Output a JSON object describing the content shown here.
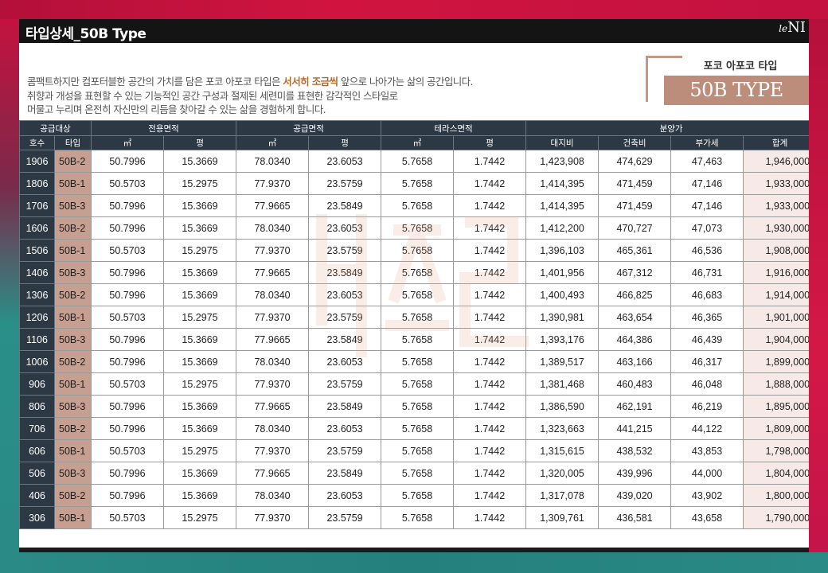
{
  "header": {
    "title": "타입상세_50B Type",
    "logo_main": "NI",
    "logo_prefix": "le"
  },
  "intro": {
    "line1_before": "콤팩트하지만 컴포터블한 공간의 가치를 담은 포코 아포코 타입은 ",
    "line1_highlight": "서서히 조금씩",
    "line1_after": " 앞으로 나아가는 삶의 공간입니다.",
    "line2": "취향과 개성을 표현할 수 있는 기능적인 공간 구성과 절제된 세련미를 표현한 감각적인 스타일로",
    "line3": "머물고 누리며 온전히 자신만의 리듬을 찾아갈 수 있는 삶을 경험하게 합니다."
  },
  "type_badge": {
    "label": "포코 아포코 타입",
    "type": "50B TYPE"
  },
  "table": {
    "groups": [
      "공급대상",
      "전용면적",
      "공급면적",
      "테라스면적",
      "분양가"
    ],
    "columns": [
      "호수",
      "타입",
      "㎡",
      "평",
      "㎡",
      "평",
      "㎡",
      "평",
      "대지비",
      "건축비",
      "부가세",
      "합계"
    ],
    "rows": [
      [
        "1906",
        "50B-2",
        "50.7996",
        "15.3669",
        "78.0340",
        "23.6053",
        "5.7658",
        "1.7442",
        "1,423,908",
        "474,629",
        "47,463",
        "1,946,000"
      ],
      [
        "1806",
        "50B-1",
        "50.5703",
        "15.2975",
        "77.9370",
        "23.5759",
        "5.7658",
        "1.7442",
        "1,414,395",
        "471,459",
        "47,146",
        "1,933,000"
      ],
      [
        "1706",
        "50B-3",
        "50.7996",
        "15.3669",
        "77.9665",
        "23.5849",
        "5.7658",
        "1.7442",
        "1,414,395",
        "471,459",
        "47,146",
        "1,933,000"
      ],
      [
        "1606",
        "50B-2",
        "50.7996",
        "15.3669",
        "78.0340",
        "23.6053",
        "5.7658",
        "1.7442",
        "1,412,200",
        "470,727",
        "47,073",
        "1,930,000"
      ],
      [
        "1506",
        "50B-1",
        "50.5703",
        "15.2975",
        "77.9370",
        "23.5759",
        "5.7658",
        "1.7442",
        "1,396,103",
        "465,361",
        "46,536",
        "1,908,000"
      ],
      [
        "1406",
        "50B-3",
        "50.7996",
        "15.3669",
        "77.9665",
        "23.5849",
        "5.7658",
        "1.7442",
        "1,401,956",
        "467,312",
        "46,731",
        "1,916,000"
      ],
      [
        "1306",
        "50B-2",
        "50.7996",
        "15.3669",
        "78.0340",
        "23.6053",
        "5.7658",
        "1.7442",
        "1,400,493",
        "466,825",
        "46,683",
        "1,914,000"
      ],
      [
        "1206",
        "50B-1",
        "50.5703",
        "15.2975",
        "77.9370",
        "23.5759",
        "5.7658",
        "1.7442",
        "1,390,981",
        "463,654",
        "46,365",
        "1,901,000"
      ],
      [
        "1106",
        "50B-3",
        "50.7996",
        "15.3669",
        "77.9665",
        "23.5849",
        "5.7658",
        "1.7442",
        "1,393,176",
        "464,386",
        "46,439",
        "1,904,000"
      ],
      [
        "1006",
        "50B-2",
        "50.7996",
        "15.3669",
        "78.0340",
        "23.6053",
        "5.7658",
        "1.7442",
        "1,389,517",
        "463,166",
        "46,317",
        "1,899,000"
      ],
      [
        "906",
        "50B-1",
        "50.5703",
        "15.2975",
        "77.9370",
        "23.5759",
        "5.7658",
        "1.7442",
        "1,381,468",
        "460,483",
        "46,048",
        "1,888,000"
      ],
      [
        "806",
        "50B-3",
        "50.7996",
        "15.3669",
        "77.9665",
        "23.5849",
        "5.7658",
        "1.7442",
        "1,386,590",
        "462,191",
        "46,219",
        "1,895,000"
      ],
      [
        "706",
        "50B-2",
        "50.7996",
        "15.3669",
        "78.0340",
        "23.6053",
        "5.7658",
        "1.7442",
        "1,323,663",
        "441,215",
        "44,122",
        "1,809,000"
      ],
      [
        "606",
        "50B-1",
        "50.5703",
        "15.2975",
        "77.9370",
        "23.5759",
        "5.7658",
        "1.7442",
        "1,315,615",
        "438,532",
        "43,853",
        "1,798,000"
      ],
      [
        "506",
        "50B-3",
        "50.7996",
        "15.3669",
        "77.9665",
        "23.5849",
        "5.7658",
        "1.7442",
        "1,320,005",
        "439,996",
        "44,000",
        "1,804,000"
      ],
      [
        "406",
        "50B-2",
        "50.7996",
        "15.3669",
        "78.0340",
        "23.6053",
        "5.7658",
        "1.7442",
        "1,317,078",
        "439,020",
        "43,902",
        "1,800,000"
      ],
      [
        "306",
        "50B-1",
        "50.5703",
        "15.2975",
        "77.9370",
        "23.5759",
        "5.7658",
        "1.7442",
        "1,309,761",
        "436,581",
        "43,658",
        "1,790,000"
      ]
    ]
  },
  "colors": {
    "header_dark": "#2c3843",
    "type_cell": "#c79f90",
    "total_cell": "#f7e9e6",
    "highlight_text": "#b46a2a",
    "badge": "#bc8d7b",
    "frame_red": "#c4123f",
    "frame_teal": "#2a8a86"
  }
}
